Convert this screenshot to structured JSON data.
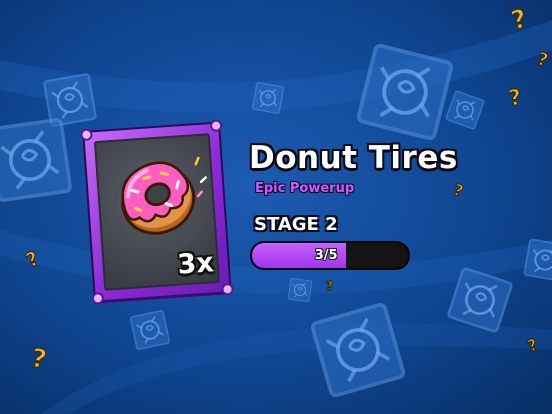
{
  "powerup": {
    "name": "Donut Tires",
    "rarity_label": "Epic Powerup",
    "count_label": "3x",
    "icon": "donut-icon"
  },
  "stage": {
    "label": "STAGE 2",
    "progress_text": "3/5",
    "progress_fraction": 0.6
  },
  "colors": {
    "background": "#0b3f86",
    "rarity": "#c95cff",
    "card_frame": "#8d2bd8",
    "progress_fill": "#b04af7"
  }
}
